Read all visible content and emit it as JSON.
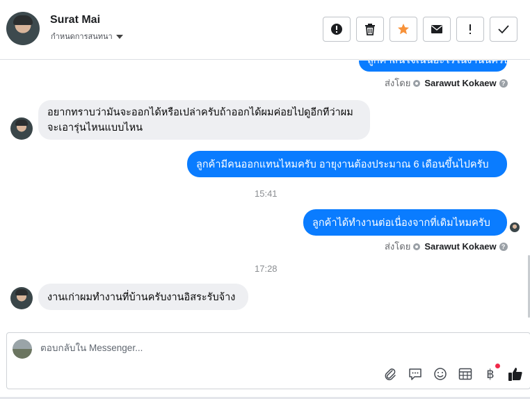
{
  "header": {
    "name": "Surat Mai",
    "subtitle": "กำหนดการสนทนา"
  },
  "messages": {
    "partial_out": "ลูกค้าสนใจเน้นอะไรในงานนี้ครับ",
    "sent_by_label": "ส่งโดย",
    "sender": "Sarawut Kokaew",
    "in_1": "อยากทราบว่ามันจะออกได้หรือเปล่าครับถ้าออกได้ผมค่อยไปดูอีกทีว่าผมจะเอารุ่นไหนแบบไหน",
    "out_1": "ลูกค้ามีคนออกแทนไหมครับ อายุงานต้องประมาณ 6 เดือนขึ้นไปครับ",
    "time_1": "15:41",
    "out_2": "ลูกค้าได้ทำงานต่อเนื่องจากที่เดิมไหมครับ",
    "time_2": "17:28",
    "in_2": "งานเก่าผมทำงานที่บ้านครับงานอิสระรับจ้าง"
  },
  "composer": {
    "placeholder": "ตอบกลับใน Messenger..."
  },
  "icons": {
    "actions": [
      "alert-circle-icon",
      "trash-icon",
      "star-icon",
      "envelope-icon",
      "exclamation-icon",
      "check-icon"
    ],
    "tools": [
      "paperclip-icon",
      "message-icon",
      "emoji-icon",
      "table-icon",
      "baht-icon",
      "like-icon"
    ]
  },
  "colors": {
    "outgoing_bubble": "#0a7cff",
    "incoming_bubble": "#eeeff2",
    "star": "#f7923a",
    "notification_dot": "#f02849"
  }
}
